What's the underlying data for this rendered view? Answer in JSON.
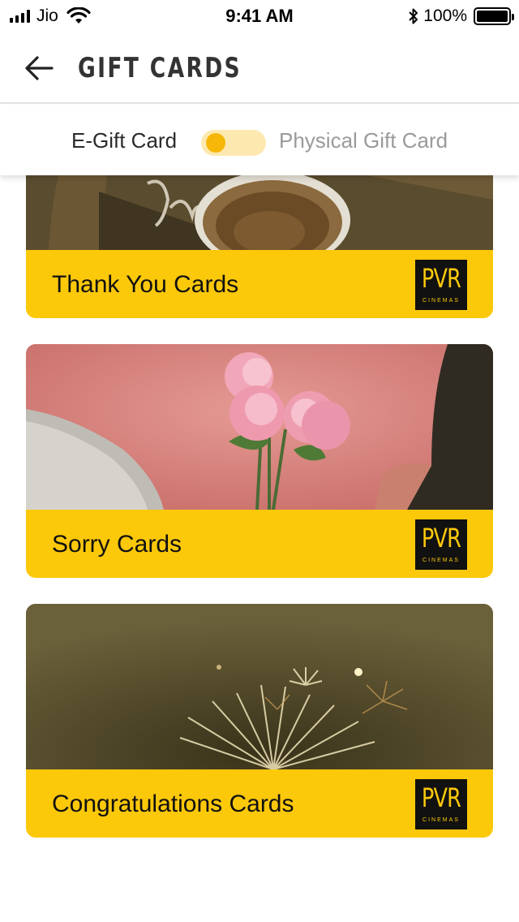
{
  "status_bar": {
    "carrier": "Jio",
    "time": "9:41 AM",
    "battery": "100%"
  },
  "header": {
    "title": "GIFT CARDS",
    "back_icon": "arrow-left-icon"
  },
  "toggle": {
    "left_label": "E-Gift Card",
    "right_label": "Physical Gift Card",
    "state": "E-Gift Card"
  },
  "cards": [
    {
      "label": "Thank You Cards",
      "logo_text": "PVR",
      "logo_sub": "CINEMAS"
    },
    {
      "label": "Sorry Cards",
      "logo_text": "PVR",
      "logo_sub": "CINEMAS"
    },
    {
      "label": "Congratulations Cards",
      "logo_text": "PVR",
      "logo_sub": "CINEMAS"
    }
  ],
  "colors": {
    "accent_yellow": "#fcc80a",
    "toggle_track": "#fde9b0",
    "toggle_knob": "#f7b708",
    "logo_bg": "#111111"
  }
}
